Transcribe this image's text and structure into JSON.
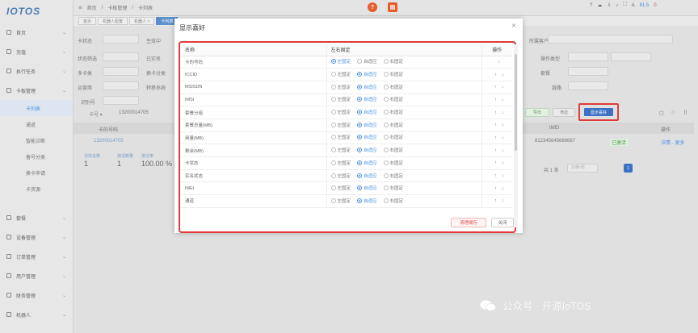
{
  "app": {
    "logo_text": "IOTOS"
  },
  "sidebar": {
    "items": [
      {
        "label": "首页"
      },
      {
        "label": "充值"
      },
      {
        "label": "执行任务"
      },
      {
        "label": "卡板管理"
      }
    ],
    "sub_items": [
      {
        "label": "卡列表"
      },
      {
        "label": "通道"
      },
      {
        "label": "智能诊断"
      },
      {
        "label": "备号分类"
      },
      {
        "label": "换卡申请"
      },
      {
        "label": "卡资源"
      }
    ],
    "bottom_items": [
      {
        "label": "套餐"
      },
      {
        "label": "设备管理"
      },
      {
        "label": "订单管理"
      },
      {
        "label": "用户管理"
      },
      {
        "label": "财务管理"
      },
      {
        "label": "机器人"
      }
    ]
  },
  "topbar": {
    "breadcrumb_home": "首页",
    "breadcrumb_2": "卡板管理",
    "breadcrumb_3": "卡列表",
    "right_count": "81.5",
    "right_text": "0"
  },
  "tabs": [
    {
      "label": "首页"
    },
    {
      "label": "机器人配置"
    },
    {
      "label": "机器人 ×"
    },
    {
      "label": "卡列表"
    }
  ],
  "filters": {
    "l1": "卡状态",
    "l2": "生效中",
    "l3": "所属客户",
    "l4": "状态筛选",
    "l5": "已实名",
    "l6": "操作类型",
    "l7": "多卡类",
    "l8": "换卡分类",
    "l9": "套餐",
    "l10": "运营商",
    "l11": "转移系统",
    "l12": "链路",
    "l13": "识别号",
    "search_value": "13200014705"
  },
  "toolbar": {
    "highlight_label": "显示喜好"
  },
  "stats": [
    {
      "value": "1",
      "label": "当前总数"
    },
    {
      "value": "1",
      "label": "激活数量"
    },
    {
      "value": "100.00 %",
      "label": "激活率"
    }
  ],
  "pagination": {
    "total": "共 1 条",
    "page": "1",
    "per_page": "10条/页"
  },
  "modal": {
    "title": "显示喜好",
    "col_name": "名称",
    "col_fixed": "左右固定",
    "col_ops": "操作",
    "opt_left": "左固定",
    "opt_auto": "自适应",
    "opt_right": "右固定",
    "rows": [
      {
        "name": "卡的号码",
        "sel": "left"
      },
      {
        "name": "ICCID",
        "sel": "auto"
      },
      {
        "name": "MSISDN",
        "sel": "auto"
      },
      {
        "name": "IMSI",
        "sel": "auto"
      },
      {
        "name": "套餐分组",
        "sel": "auto"
      },
      {
        "name": "套餐总量(MB)",
        "sel": "auto"
      },
      {
        "name": "用量(MB)",
        "sel": "auto"
      },
      {
        "name": "剩余(MB)",
        "sel": "auto"
      },
      {
        "name": "卡状态",
        "sel": "auto"
      },
      {
        "name": "实名状态",
        "sel": "auto"
      },
      {
        "name": "IMEI",
        "sel": "auto"
      },
      {
        "name": "通道",
        "sel": "auto"
      }
    ],
    "clear_label": "清理缓存",
    "close_label": "关闭"
  },
  "watermark": {
    "text": "公众号 · 开源IoTOS"
  }
}
